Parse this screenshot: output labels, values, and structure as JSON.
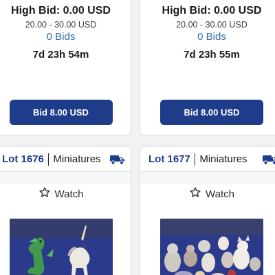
{
  "top_cards": [
    {
      "high_bid": "High Bid: 0.00 USD",
      "estimate": "20.00 - 30.00 USD",
      "bids": "0 Bids",
      "time_left": "7d 23h 54m",
      "bid_button": "Bid 8.00 USD"
    },
    {
      "high_bid": "High Bid: 0.00 USD",
      "estimate": "20.00 - 30.00 USD",
      "bids": "0 Bids",
      "time_left": "7d 23h 55m",
      "bid_button": "Bid 8.00 USD"
    }
  ],
  "bottom_cards": [
    {
      "lot": "Lot 1676",
      "category": "Miniatures",
      "watch_label": "Watch",
      "shipping_icon": "truck-icon",
      "watch_icon": "star-outline-icon"
    },
    {
      "lot": "Lot 1677",
      "category": "Miniatures",
      "watch_label": "Watch",
      "shipping_icon": "truck-icon",
      "watch_icon": "star-outline-icon"
    }
  ],
  "colors": {
    "brand_navy": "#1f3c8a",
    "bids_link": "#2f6fa3",
    "photo_background": "#2c3a8c"
  }
}
